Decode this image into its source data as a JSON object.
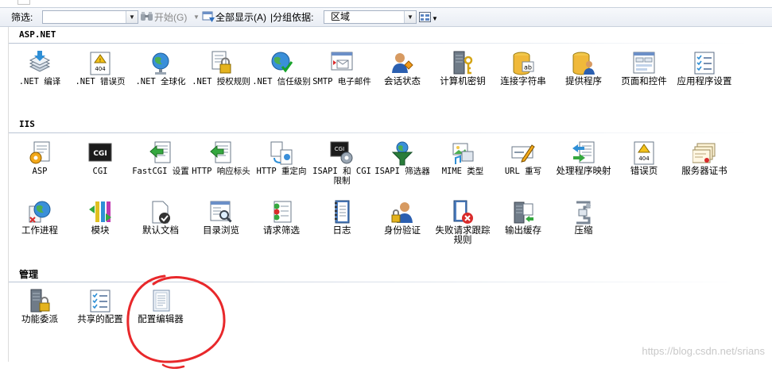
{
  "toolbar": {
    "filter_label": "筛选:",
    "filter_value": "",
    "start_label": "开始(G)",
    "show_all_label": "全部显示(A)",
    "group_by_label": "|分组依据:",
    "group_by_value": "区域",
    "view_icon": "view-grid-icon"
  },
  "sections": {
    "aspnet": {
      "title": "ASP.NET",
      "items": [
        {
          "label": ".NET 编译",
          "icon": "stack-down-arrow-icon"
        },
        {
          "label": ".NET 错误页",
          "icon": "error-404-page-icon"
        },
        {
          "label": ".NET 全球化",
          "icon": "globe-icon"
        },
        {
          "label": ".NET 授权规则",
          "icon": "lock-document-icon"
        },
        {
          "label": ".NET 信任级别",
          "icon": "globe-checkmark-icon"
        },
        {
          "label": "SMTP 电子邮件",
          "icon": "email-window-icon"
        },
        {
          "label": "会话状态",
          "icon": "user-session-icon"
        },
        {
          "label": "计算机密钥",
          "icon": "server-key-icon"
        },
        {
          "label": "连接字符串",
          "icon": "database-ab-icon"
        },
        {
          "label": "提供程序",
          "icon": "database-user-icon"
        },
        {
          "label": "页面和控件",
          "icon": "page-controls-icon"
        },
        {
          "label": "应用程序设置",
          "icon": "checklist-icon"
        }
      ]
    },
    "iis": {
      "title": "IIS",
      "items": [
        {
          "label": "ASP",
          "icon": "asp-gear-icon"
        },
        {
          "label": "CGI",
          "icon": "cgi-terminal-icon"
        },
        {
          "label": "FastCGI 设置",
          "icon": "fastcgi-arrow-icon"
        },
        {
          "label": "HTTP 响应标头",
          "icon": "http-header-arrow-icon"
        },
        {
          "label": "HTTP 重定向",
          "icon": "redirect-icon"
        },
        {
          "label": "ISAPI 和 CGI 限制",
          "icon": "isapi-gear-icon"
        },
        {
          "label": "ISAPI 筛选器",
          "icon": "funnel-globe-icon"
        },
        {
          "label": "MIME 类型",
          "icon": "mime-media-icon"
        },
        {
          "label": "URL 重写",
          "icon": "url-rewrite-pen-icon"
        },
        {
          "label": "处理程序映射",
          "icon": "handler-arrows-icon"
        },
        {
          "label": "错误页",
          "icon": "error-404-icon"
        },
        {
          "label": "服务器证书",
          "icon": "certificates-icon"
        },
        {
          "label": "工作进程",
          "icon": "worker-process-globe-icon"
        },
        {
          "label": "模块",
          "icon": "modules-arrows-icon"
        },
        {
          "label": "默认文档",
          "icon": "default-document-check-icon"
        },
        {
          "label": "目录浏览",
          "icon": "directory-magnifier-icon"
        },
        {
          "label": "请求筛选",
          "icon": "request-filter-icon"
        },
        {
          "label": "日志",
          "icon": "log-book-icon"
        },
        {
          "label": "身份验证",
          "icon": "user-lock-icon"
        },
        {
          "label": "失败请求跟踪规则",
          "icon": "failed-request-x-icon"
        },
        {
          "label": "输出缓存",
          "icon": "output-cache-icon"
        },
        {
          "label": "压缩",
          "icon": "compression-clamp-icon"
        }
      ]
    },
    "management": {
      "title": "管理",
      "items": [
        {
          "label": "功能委派",
          "icon": "server-lock-icon"
        },
        {
          "label": "共享的配置",
          "icon": "shared-config-checklist-icon"
        },
        {
          "label": "配置编辑器",
          "icon": "config-editor-document-icon"
        }
      ]
    }
  },
  "annotation": {
    "color": "#e8282b",
    "target": "配置编辑器"
  },
  "watermark": "https://blog.csdn.net/srians"
}
